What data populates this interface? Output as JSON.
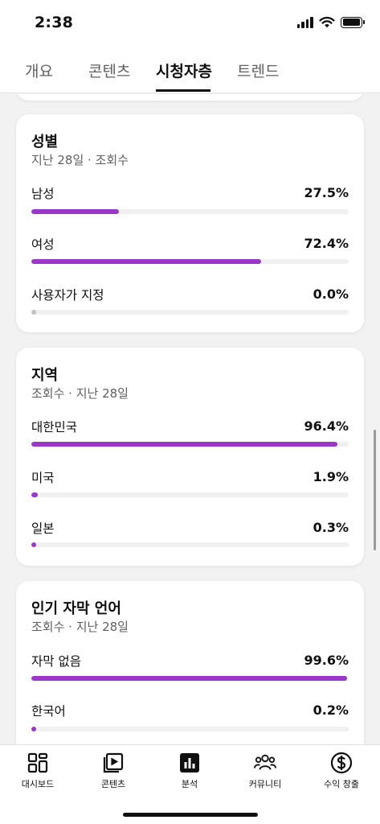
{
  "status": {
    "time": "2:38"
  },
  "tabs": [
    {
      "label": "개요"
    },
    {
      "label": "콘텐츠"
    },
    {
      "label": "시청자층"
    },
    {
      "label": "트렌드"
    }
  ],
  "active_tab": "시청자층",
  "gender": {
    "title": "성별",
    "subtitle": "지난 28일 · 조회수",
    "rows": [
      {
        "label": "남성",
        "value": "27.5%",
        "fraction": 0.275
      },
      {
        "label": "여성",
        "value": "72.4%",
        "fraction": 0.724
      },
      {
        "label": "사용자가 지정",
        "value": "0.0%",
        "fraction": 0.0
      }
    ]
  },
  "region": {
    "title": "지역",
    "subtitle": "조회수 · 지난 28일",
    "rows": [
      {
        "label": "대한민국",
        "value": "96.4%",
        "fraction": 0.964
      },
      {
        "label": "미국",
        "value": "1.9%",
        "fraction": 0.019
      },
      {
        "label": "일본",
        "value": "0.3%",
        "fraction": 0.003
      }
    ]
  },
  "subtitles": {
    "title": "인기 자막 언어",
    "subtitle": "조회수 · 지난 28일",
    "rows": [
      {
        "label": "자막 없음",
        "value": "99.6%",
        "fraction": 0.996
      },
      {
        "label": "한국어",
        "value": "0.2%",
        "fraction": 0.002
      }
    ]
  },
  "bottom_nav": [
    {
      "label": "대시보드",
      "icon": "dashboard-icon"
    },
    {
      "label": "콘텐츠",
      "icon": "content-play-icon"
    },
    {
      "label": "분석",
      "icon": "analytics-icon"
    },
    {
      "label": "커뮤니티",
      "icon": "community-icon"
    },
    {
      "label": "수익 창출",
      "icon": "monetization-dollar-icon"
    }
  ],
  "colors": {
    "accent": "#9b37c8",
    "track": "#f0f0f0",
    "zero_dot": "#c2c2c2"
  }
}
